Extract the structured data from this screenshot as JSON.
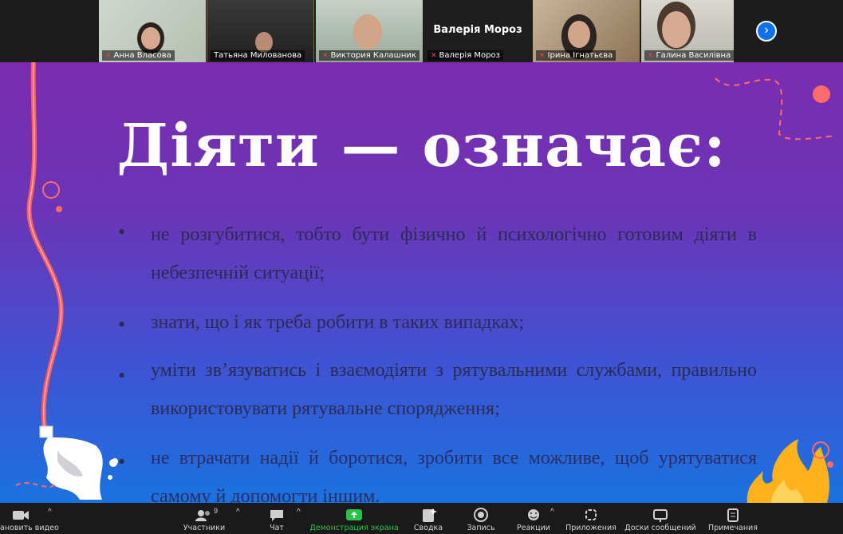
{
  "participants": [
    {
      "name": "Анна Власова",
      "muted": true
    },
    {
      "name": "Татьяна Милованова",
      "muted": false
    },
    {
      "name": "Виктория Калашник",
      "muted": true
    },
    {
      "name": "Валерія Мороз",
      "muted": true,
      "display_name": "Валерія Мороз"
    },
    {
      "name": "Ірина Ігнатьєва",
      "muted": true
    },
    {
      "name": "Галина Василівна",
      "muted": true
    }
  ],
  "slide": {
    "title": "Діяти — означає:",
    "bullets": [
      "не розгубитися, тобто бути фізично й психологічно готовим діяти в небезпечній ситуації;",
      "знати, що і як треба робити в таких випадках;",
      "уміти зв’язуватись і взаємодіяти з рятувальними службами, правильно використовувати рятувальне спорядження;",
      "не втрачати надії й боротися, зробити все можливе, щоб урятуватися самому й допомогти іншим."
    ]
  },
  "toolbar": {
    "video_label": "ановить видео",
    "participants_label": "Участники",
    "participants_count": "9",
    "chat_label": "Чат",
    "share_label": "Демонстрация экрана",
    "summary_label": "Сводка",
    "record_label": "Запись",
    "reactions_label": "Реакции",
    "apps_label": "Приложения",
    "boards_label": "Доски сообщений",
    "notes_label": "Примечания"
  },
  "colors": {
    "share_green": "#27c34a",
    "zoom_blue": "#0e71eb",
    "muted_red": "#e54545"
  }
}
